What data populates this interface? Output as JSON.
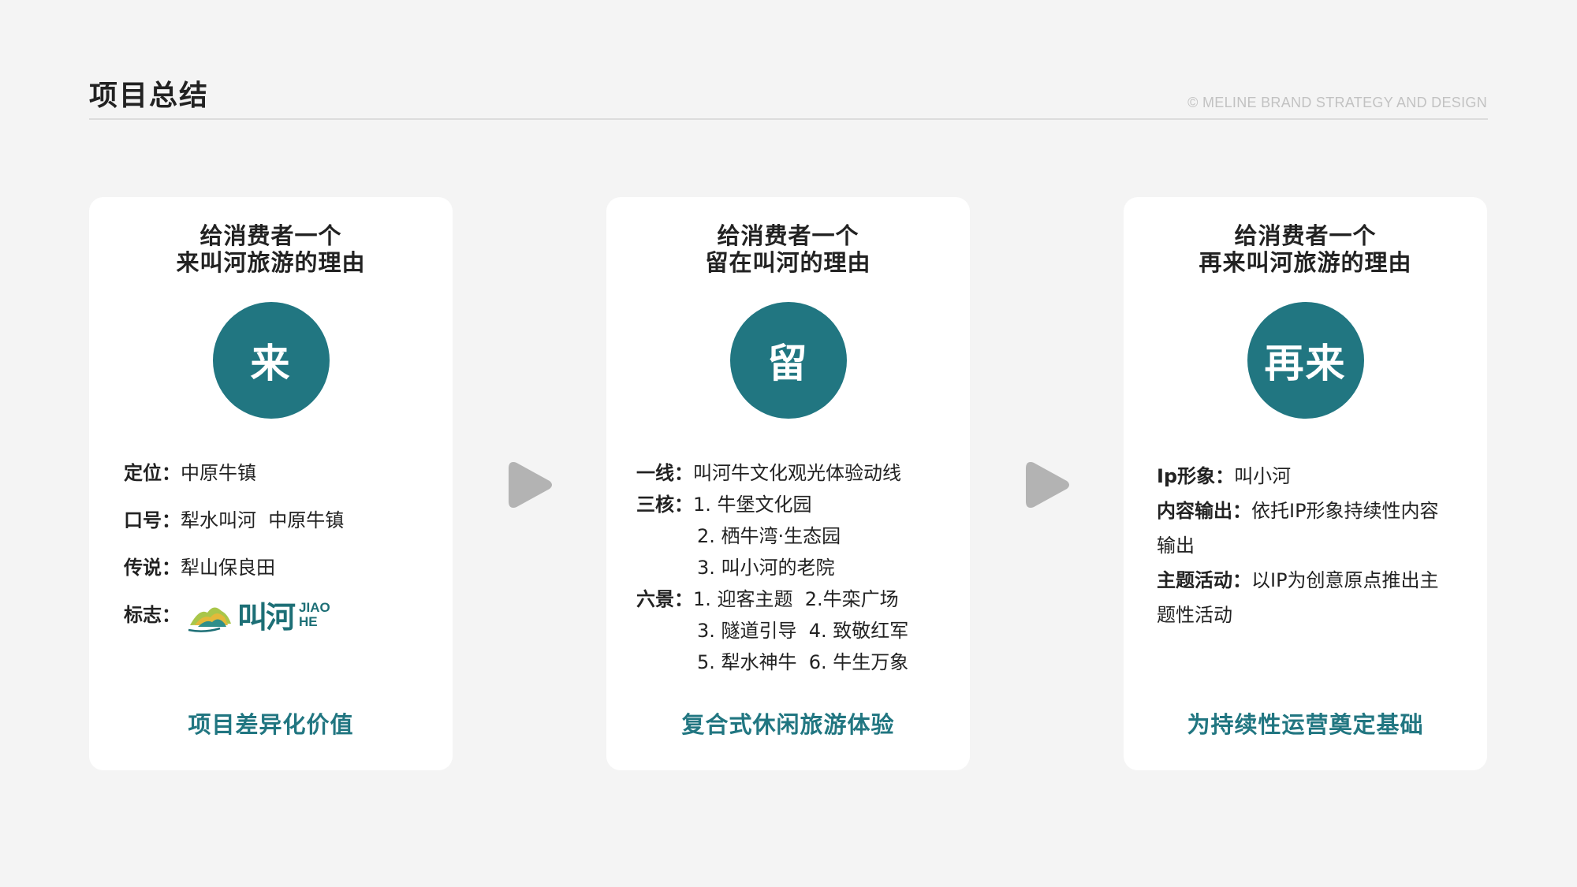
{
  "header": {
    "title": "项目总结",
    "copyright": "© MELINE BRAND STRATEGY AND DESIGN"
  },
  "cards": [
    {
      "heading_line1": "给消费者一个",
      "heading_line2": "来叫河旅游的理由",
      "circle": "来",
      "items": [
        {
          "label": "定位：",
          "value": "中原牛镇"
        },
        {
          "label": "口号：",
          "value": "犁水叫河  中原牛镇"
        },
        {
          "label": "传说：",
          "value": "犁山保良田"
        },
        {
          "label": "标志：",
          "value": ""
        }
      ],
      "logo": {
        "cn": "叫河",
        "en1": "JIAO",
        "en2": "HE"
      },
      "footer": "项目差异化价值"
    },
    {
      "heading_line1": "给消费者一个",
      "heading_line2": "留在叫河的理由",
      "circle": "留",
      "items": [
        {
          "label": "一线：",
          "value": "叫河牛文化观光体验动线"
        },
        {
          "label": "三核：",
          "value": "1. 牛堡文化园"
        },
        {
          "label": "",
          "value": "2. 栖牛湾·生态园"
        },
        {
          "label": "",
          "value": "3. 叫小河的老院"
        },
        {
          "label": "六景：",
          "value": "1. 迎客主题  2.牛栾广场"
        },
        {
          "label": "",
          "value": "3. 隧道引导  4. 致敬红军"
        },
        {
          "label": "",
          "value": "5. 犁水神牛  6. 牛生万象"
        }
      ],
      "footer": "复合式休闲旅游体验"
    },
    {
      "heading_line1": "给消费者一个",
      "heading_line2": "再来叫河旅游的理由",
      "circle": "再来",
      "items": [
        {
          "label": "Ip形象：",
          "value": "叫小河"
        },
        {
          "label": "内容输出：",
          "value": "依托IP形象持续性内容输出"
        },
        {
          "label": "主题活动：",
          "value": "以IP为创意原点推出主题性活动"
        }
      ],
      "footer": "为持续性运营奠定基础"
    }
  ],
  "colors": {
    "accent": "#217681",
    "background": "#f4f4f4",
    "card": "#ffffff",
    "arrow": "#b3b3b3"
  }
}
